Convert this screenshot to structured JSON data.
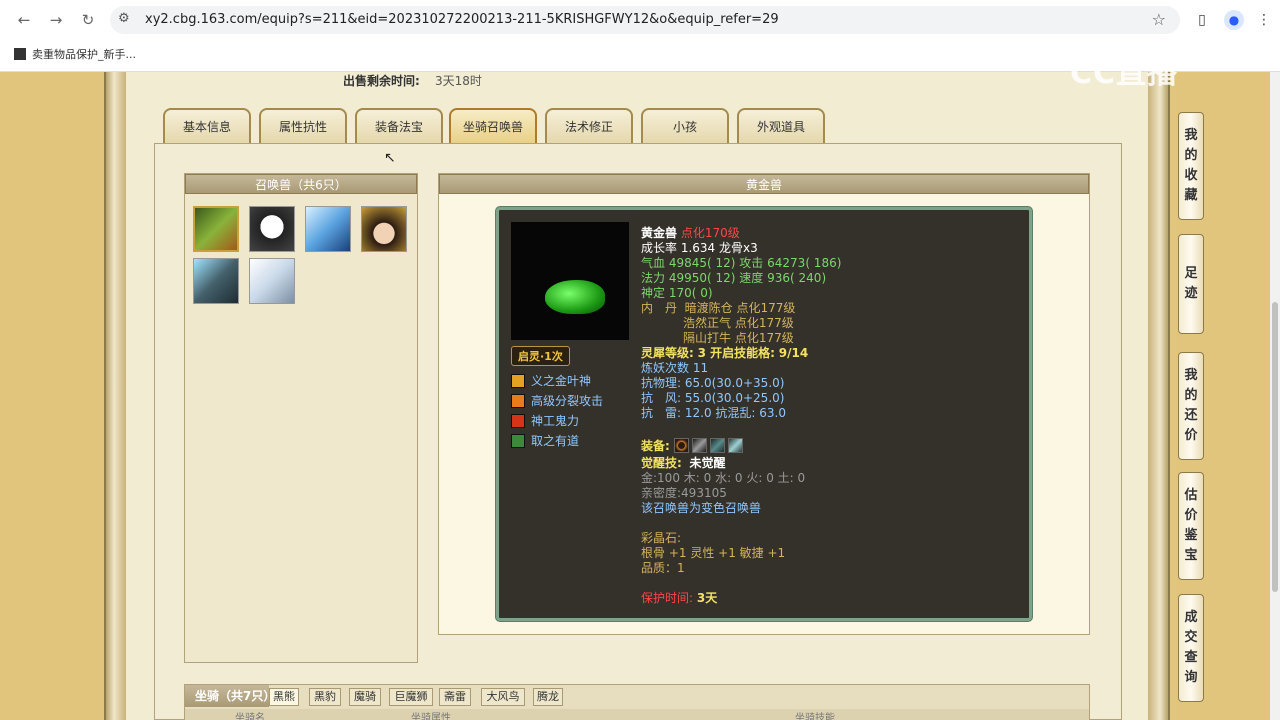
{
  "browser": {
    "url": "xy2.cbg.163.com/equip?s=211&eid=202310272200213-211-5KRISHGFWY12&o&equip_refer=29",
    "bookmark_label": "卖重物品保护_新手..."
  },
  "watermark": "CC直播",
  "sale": {
    "label": "出售剩余时间:",
    "value": "3天18时"
  },
  "tabs": [
    {
      "label": "基本信息"
    },
    {
      "label": "属性抗性"
    },
    {
      "label": "装备法宝"
    },
    {
      "label": "坐骑召唤兽"
    },
    {
      "label": "法术修正"
    },
    {
      "label": "小孩"
    },
    {
      "label": "外观道具"
    }
  ],
  "pets_panel": {
    "title": "召唤兽（共6只）"
  },
  "detail_panel": {
    "title": "黄金兽"
  },
  "card": {
    "name": "黄金兽",
    "level": "点化170级",
    "growth_line": "成长率 1.634 龙骨x3",
    "hp_label": "气血",
    "hp": "49845( 12)",
    "atk_label": "攻击",
    "atk": "64273( 186)",
    "mp_label": "法力",
    "mp": "49950( 12)",
    "spd_label": "速度",
    "spd": "936( 240)",
    "shen_label": "神定",
    "shen": "170( 0)",
    "neidan_label": "内　丹",
    "neidan": [
      "暗渡陈仓 点化177级",
      "浩然正气 点化177级",
      "隔山打牛 点化177级"
    ],
    "lingxi_label": "灵犀等级:",
    "lingxi": "3 开启技能格:",
    "lingxi_slots": "9/14",
    "lianyao": "炼妖次数 11",
    "kang1_label": "抗物理:",
    "kang1": "65.0(30.0+35.0)",
    "kang2_label": "抗　风:",
    "kang2": "55.0(30.0+25.0)",
    "kang3_label": "抗　雷:",
    "kang3": "12.0 抗混乱: 63.0",
    "equip_label": "装备:",
    "awaken_label": "觉醒技:",
    "awaken_value": "未觉醒",
    "elements": "金:100 木: 0 水: 0 火: 0 土: 0",
    "intimacy": "亲密度:493105",
    "variant": "该召唤兽为变色召唤兽",
    "crystal_label": "彩晶石:",
    "crystal_stats": "根骨 +1 灵性 +1 敏捷 +1",
    "quality": "品质：1",
    "protect_label": "保护时间:",
    "protect_value": "3天"
  },
  "awaken_badge": "启灵·1次",
  "skills": [
    {
      "label": "义之金叶神"
    },
    {
      "label": "高级分裂攻击"
    },
    {
      "label": "神工鬼力"
    },
    {
      "label": "取之有道"
    }
  ],
  "mount_panel": {
    "title": "坐骑（共7只）",
    "tabs": [
      "黑熊",
      "黑豹",
      "魔骑",
      "巨魔狮",
      "斋雷",
      "大风鸟",
      "腾龙"
    ],
    "col1": "坐骑名",
    "col2": "坐骑属性",
    "col3": "坐骑技能"
  },
  "side_buttons": [
    {
      "chars": [
        "我",
        "的",
        "收",
        "藏"
      ]
    },
    {
      "chars": [
        "足",
        "迹"
      ]
    },
    {
      "chars": [
        "我",
        "的",
        "还",
        "价"
      ]
    },
    {
      "chars": [
        "估",
        "价",
        "鉴",
        "宝"
      ]
    },
    {
      "chars": [
        "成",
        "交",
        "查",
        "询"
      ]
    }
  ],
  "colors": {
    "card_bg": "#34302a",
    "card_border": "#7fa38a",
    "accent_gold": "#d3b55a",
    "tab_active": "#e8cf84"
  }
}
